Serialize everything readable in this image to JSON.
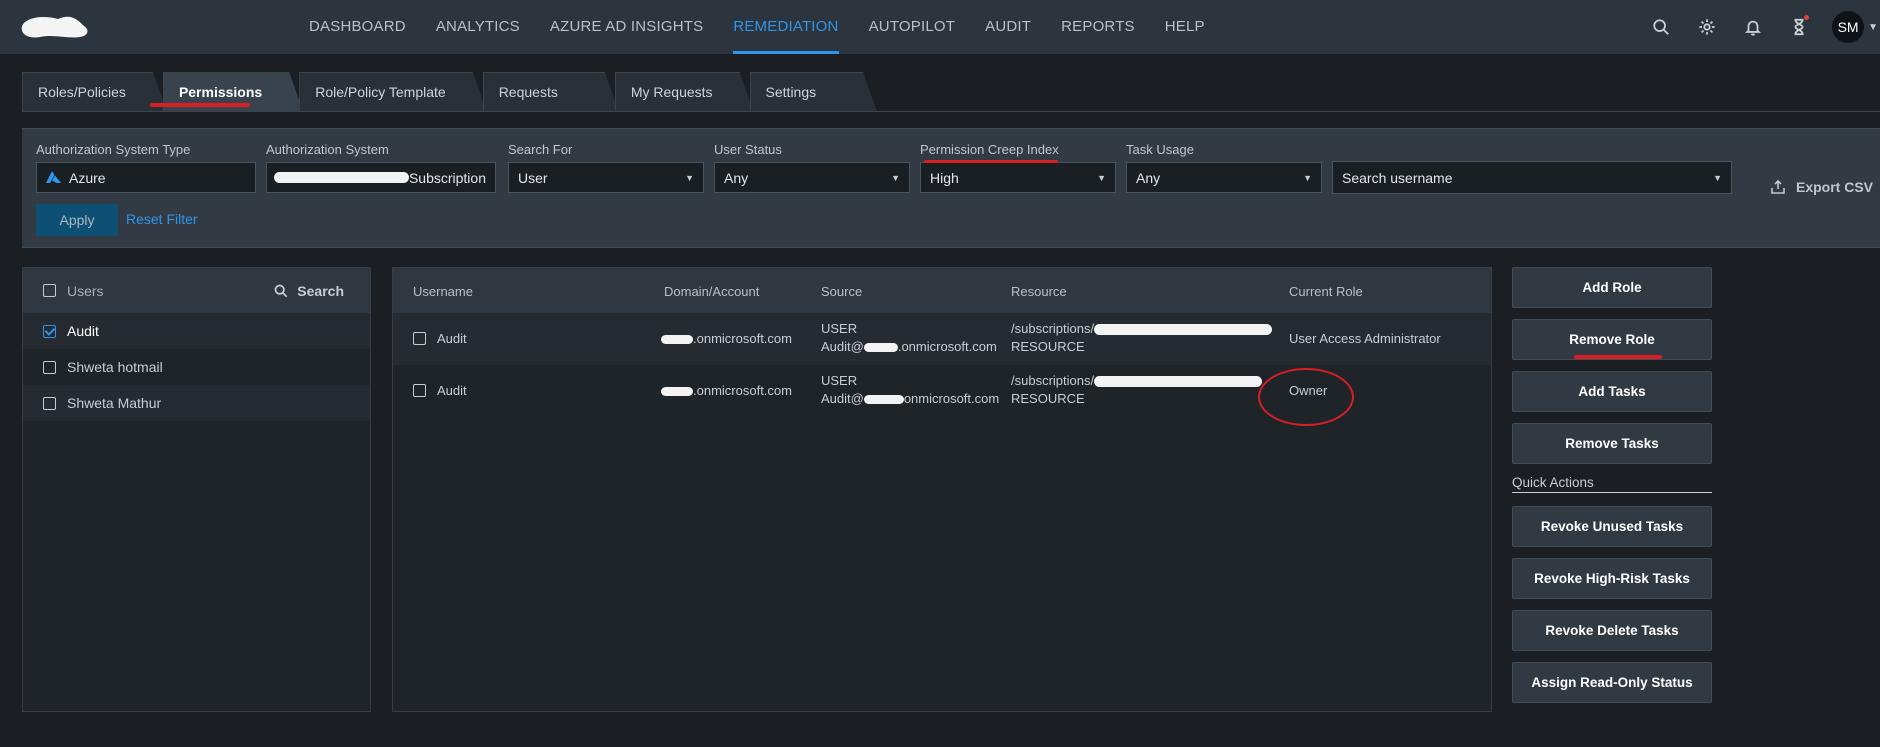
{
  "nav": {
    "items": [
      "DASHBOARD",
      "ANALYTICS",
      "AZURE AD INSIGHTS",
      "REMEDIATION",
      "AUTOPILOT",
      "AUDIT",
      "REPORTS",
      "HELP"
    ],
    "active": "REMEDIATION",
    "avatar_initials": "SM"
  },
  "tabs": [
    "Roles/Policies",
    "Permissions",
    "Role/Policy Template",
    "Requests",
    "My Requests",
    "Settings"
  ],
  "active_tab": "Permissions",
  "filters": {
    "auth_system_type": {
      "label": "Authorization System Type",
      "value": "Azure"
    },
    "auth_system": {
      "label": "Authorization System",
      "value": "Subscription"
    },
    "search_for": {
      "label": "Search For",
      "value": "User"
    },
    "user_status": {
      "label": "User Status",
      "value": "Any"
    },
    "pci": {
      "label": "Permission Creep Index",
      "value": "High"
    },
    "task_usage": {
      "label": "Task Usage",
      "value": "Any"
    },
    "search_username": {
      "value": "Search username"
    },
    "apply": "Apply",
    "reset": "Reset Filter",
    "export": "Export CSV"
  },
  "users_panel": {
    "header": "Users",
    "search": "Search",
    "items": [
      {
        "name": "Audit",
        "checked": true
      },
      {
        "name": "Shweta hotmail",
        "checked": false
      },
      {
        "name": "Shweta Mathur",
        "checked": false
      }
    ]
  },
  "table": {
    "columns": [
      "Username",
      "Domain/Account",
      "Source",
      "Resource",
      "Current Role"
    ],
    "rows": [
      {
        "username": "Audit",
        "domain": ".onmicrosoft.com",
        "source_type": "USER",
        "source_account_prefix": "Audit@",
        "source_account_suffix": ".onmicrosoft.com",
        "resource_prefix": "/subscriptions/",
        "resource_type": "RESOURCE",
        "role": "User Access Administrator"
      },
      {
        "username": "Audit",
        "domain": ".onmicrosoft.com",
        "source_type": "USER",
        "source_account_prefix": "Audit@",
        "source_account_suffix": "onmicrosoft.com",
        "resource_prefix": "/subscriptions/",
        "resource_type": "RESOURCE",
        "role": "Owner"
      }
    ]
  },
  "actions": {
    "buttons": [
      "Add Role",
      "Remove Role",
      "Add Tasks",
      "Remove Tasks"
    ],
    "quick_actions_label": "Quick Actions",
    "quick": [
      "Revoke Unused Tasks",
      "Revoke High-Risk Tasks",
      "Revoke Delete Tasks",
      "Assign Read-Only Status"
    ]
  },
  "colors": {
    "accent": "#2f95e8",
    "annotation_red": "#d81f26",
    "background": "#1b1f24",
    "panel": "#323b44"
  },
  "icons": [
    "search-icon",
    "gear-icon",
    "bell-icon",
    "hourglass-icon",
    "azure-icon",
    "export-icon"
  ]
}
